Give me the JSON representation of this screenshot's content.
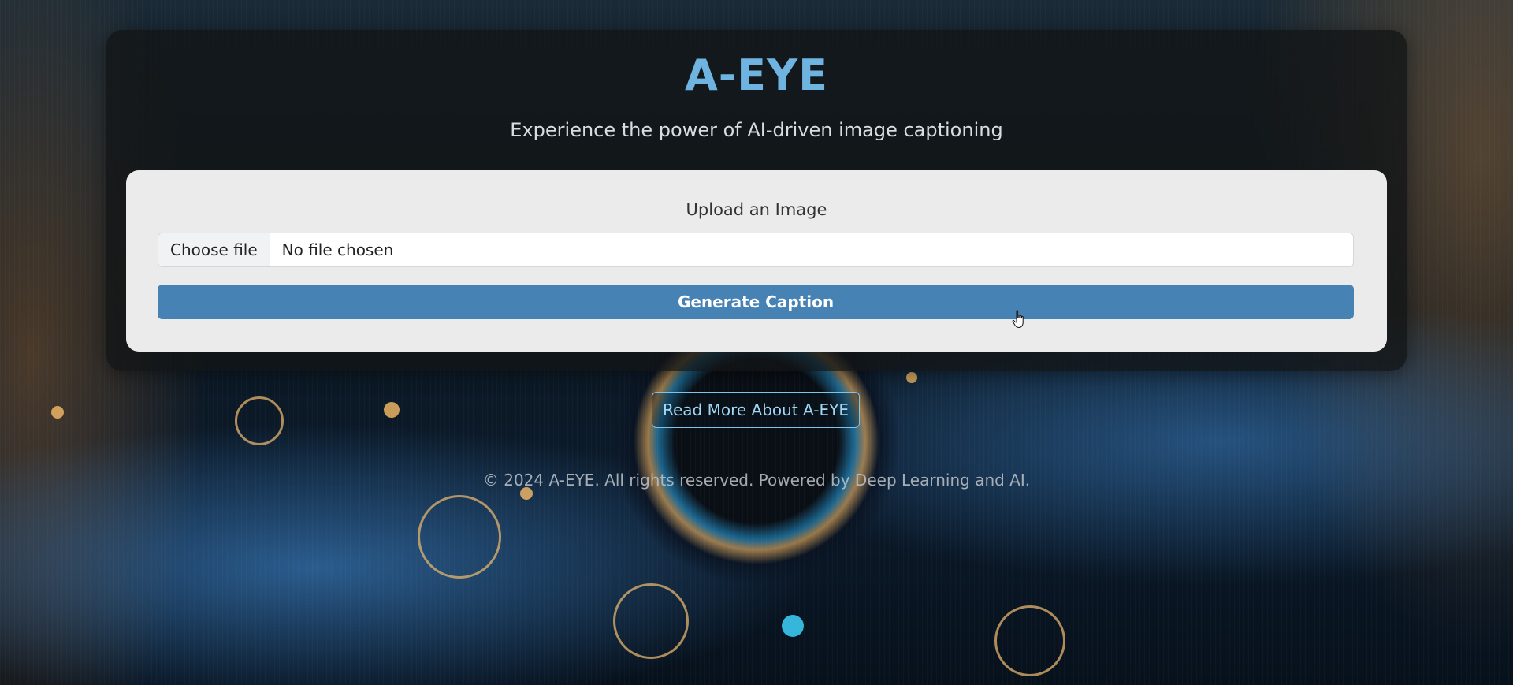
{
  "header": {
    "title": "A-EYE",
    "subtitle": "Experience the power of AI-driven image captioning"
  },
  "upload": {
    "label": "Upload an Image",
    "choose_file_label": "Choose file",
    "file_status": "No file chosen",
    "generate_label": "Generate Caption"
  },
  "links": {
    "read_more_label": "Read More About A-EYE"
  },
  "footer": {
    "text": "© 2024 A-EYE. All rights reserved. Powered by Deep Learning and AI."
  },
  "colors": {
    "title": "#6fb4e0",
    "primary_button": "#4682b4",
    "outline_button": "#7ec3ec",
    "panel": "#ebebeb"
  },
  "icons": [
    "pointer-cursor-icon"
  ]
}
